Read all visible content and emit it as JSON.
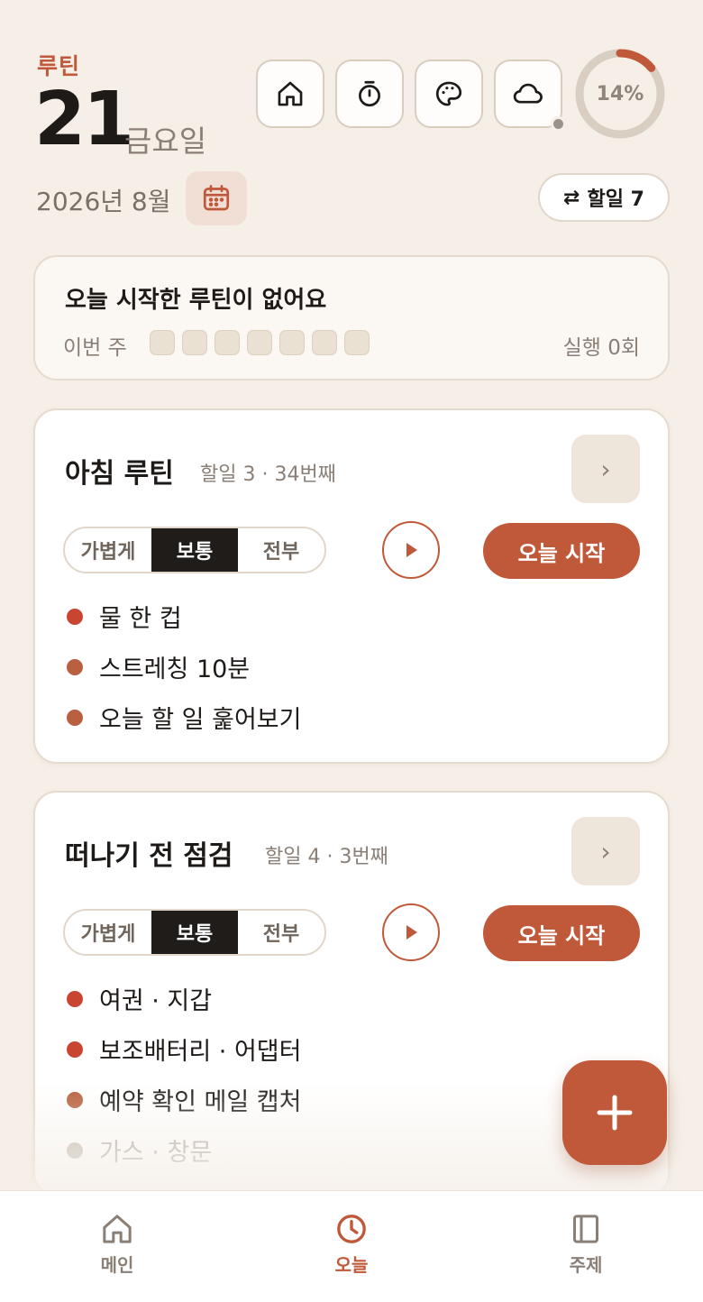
{
  "header": {
    "app_label": "루틴",
    "day": "21",
    "weekday": "금요일",
    "year_month": "2026년 8월",
    "progress_percent": 14,
    "progress_label": "14%",
    "todo_pill": "할일 7",
    "todo_pill_icon": "⇄",
    "icons": [
      "home-icon",
      "timer-icon",
      "palette-icon",
      "cloud-icon",
      "calendar-icon"
    ]
  },
  "status": {
    "title": "오늘 시작한 루틴이 없어요",
    "week_label": "이번 주",
    "week_days_done": [
      false,
      false,
      false,
      false,
      false,
      false,
      false
    ],
    "runs_label": "실행 0회"
  },
  "routines": [
    {
      "title": "아침 루틴",
      "meta": "할일 3 · 34번째",
      "modes": [
        "가볍게",
        "보통",
        "전부"
      ],
      "active_mode": "보통",
      "start_label": "오늘 시작",
      "items": [
        "물 한 컵",
        "스트레칭 10분",
        "오늘 할 일 훑어보기"
      ]
    },
    {
      "title": "떠나기 전 점검",
      "meta": "할일 4 · 3번째",
      "modes": [
        "가볍게",
        "보통",
        "전부"
      ],
      "active_mode": "보통",
      "start_label": "오늘 시작",
      "items": [
        "여권 · 지갑",
        "보조배터리 · 어댑터",
        "예약 확인 메일 캡처",
        "가스 · 창문"
      ]
    }
  ],
  "nav": {
    "items": [
      {
        "label": "메인",
        "icon": "home-icon",
        "active": false
      },
      {
        "label": "오늘",
        "icon": "clock-icon",
        "active": true
      },
      {
        "label": "주제",
        "icon": "book-icon",
        "active": false
      }
    ]
  },
  "colors": {
    "accent": "#c0583a",
    "background": "#f5efe8",
    "text": "#1d1a18",
    "muted": "#8a7f76"
  }
}
